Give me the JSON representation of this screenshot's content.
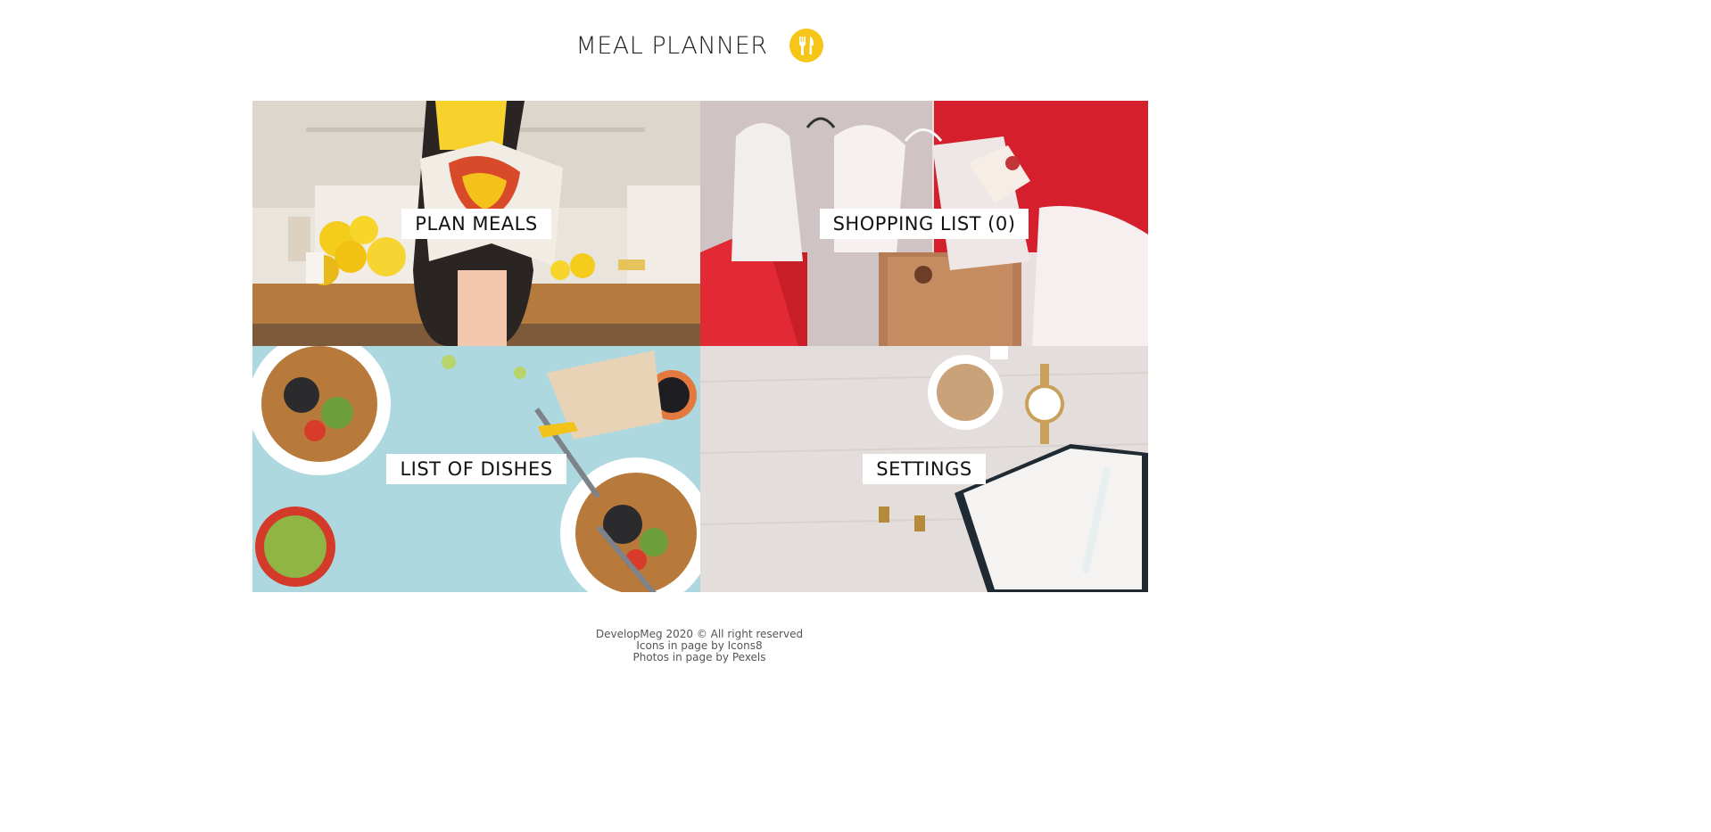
{
  "header": {
    "title": "MEAL PLANNER",
    "logo_icon": "fork-knife-icon",
    "logo_color": "#f5c518"
  },
  "tiles": [
    {
      "label": "PLAN MEALS"
    },
    {
      "label": "SHOPPING LIST (0)"
    },
    {
      "label": "LIST OF DISHES"
    },
    {
      "label": "SETTINGS"
    }
  ],
  "footer": {
    "line1": "DevelopMeg 2020 © All right reserved",
    "line2": "Icons in page by Icons8",
    "line3": "Photos in page by Pexels"
  }
}
